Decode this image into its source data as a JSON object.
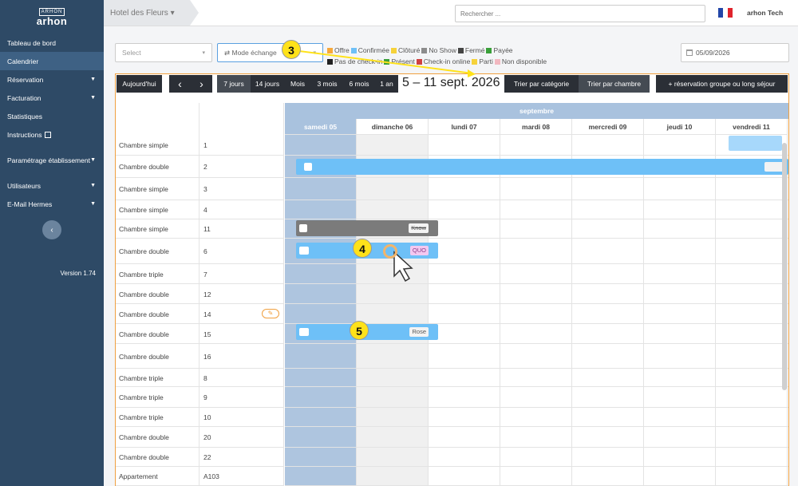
{
  "sidebar": {
    "logo_top": "ARHON",
    "logo_word": "arhon",
    "items": [
      {
        "label": "Tableau de bord",
        "chev": ""
      },
      {
        "label": "Calendrier",
        "chev": ""
      },
      {
        "label": "Réservation",
        "chev": "▼"
      },
      {
        "label": "Facturation",
        "chev": "▼"
      },
      {
        "label": "Statistiques",
        "chev": ""
      },
      {
        "label": "Instructions",
        "chev": ""
      },
      {
        "label": "Paramétrage établissement",
        "chev": "▼"
      },
      {
        "label": "Utilisateurs",
        "chev": "▼"
      },
      {
        "label": "E-Mail Hermes",
        "chev": "▼"
      }
    ],
    "collapse": "‹",
    "version": "Version 1.74"
  },
  "header": {
    "hotel": "Hotel des Fleurs ▾",
    "search_placeholder": "Rechercher ...",
    "user": "arhon Tech"
  },
  "filters": {
    "select": "Select",
    "mode": "⇄  Mode échange",
    "date": "05/09/2026",
    "legend": [
      {
        "label": "Offre",
        "color": "#f7a83a"
      },
      {
        "label": "Confirmée",
        "color": "#6ec0f7"
      },
      {
        "label": "Clôturé",
        "color": "#f6d23a"
      },
      {
        "label": "No Show",
        "color": "#8c8c8c"
      },
      {
        "label": "Fermé",
        "color": "#444444"
      },
      {
        "label": "Payée",
        "color": "#3aa03a"
      },
      {
        "label": "Pas de check-in",
        "color": "#222222"
      },
      {
        "label": "Présent",
        "color": "#3aa03a"
      },
      {
        "label": "Check-in online",
        "color": "#d04040"
      },
      {
        "label": "Parti",
        "color": "#f6d23a"
      },
      {
        "label": "Non disponible",
        "color": "#f2b8c0"
      }
    ]
  },
  "toolbar": {
    "today": "Aujourd'hui",
    "prev": "‹",
    "next": "›",
    "views": [
      "7 jours",
      "14 jours",
      "Mois",
      "3 mois",
      "6 mois",
      "1 an"
    ],
    "range": "5 – 11 sept. 2026",
    "sort_cat": "Trier par catégorie",
    "sort_room": "Trier par chambre",
    "group": "+ réservation groupe ou long séjour"
  },
  "calendar": {
    "month": "septembre",
    "days": [
      "samedi 05",
      "dimanche 06",
      "lundi 07",
      "mardi 08",
      "mercredi 09",
      "jeudi 10",
      "vendredi 11"
    ],
    "rooms": [
      {
        "cat": "Chambre simple",
        "num": "1"
      },
      {
        "cat": "Chambre double",
        "num": "2"
      },
      {
        "cat": "Chambre simple",
        "num": "3"
      },
      {
        "cat": "Chambre simple",
        "num": "4"
      },
      {
        "cat": "Chambre simple",
        "num": "11"
      },
      {
        "cat": "Chambre double",
        "num": "6"
      },
      {
        "cat": "Chambre triple",
        "num": "7"
      },
      {
        "cat": "Chambre double",
        "num": "12"
      },
      {
        "cat": "Chambre double",
        "num": "14"
      },
      {
        "cat": "Chambre double",
        "num": "15"
      },
      {
        "cat": "Chambre double",
        "num": "16"
      },
      {
        "cat": "Chambre triple",
        "num": "8"
      },
      {
        "cat": "Chambre triple",
        "num": "9"
      },
      {
        "cat": "Chambre triple",
        "num": "10"
      },
      {
        "cat": "Chambre double",
        "num": "20"
      },
      {
        "cat": "Chambre double",
        "num": "22"
      },
      {
        "cat": "Appartement",
        "num": "A103"
      }
    ],
    "tags": {
      "know": "Know",
      "quo": "QUO",
      "rose": "Rose"
    }
  },
  "annotations": {
    "c3": "3",
    "c4": "4",
    "c5": "5"
  }
}
